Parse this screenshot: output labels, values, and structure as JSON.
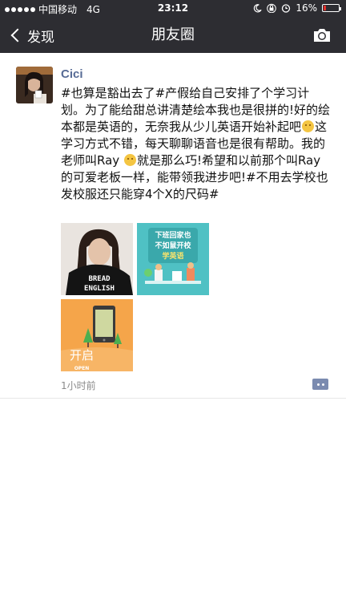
{
  "status_bar": {
    "carrier": "中国移动",
    "network": "4G",
    "time": "23:12",
    "battery": "16%",
    "battery_level": 0.16
  },
  "nav": {
    "back_label": "发现",
    "title": "朋友圈"
  },
  "post": {
    "author": "Cici",
    "text_parts": [
      "#也算是豁出去了#产假给自己安排了个学习计划。为了能给甜总讲清楚绘本我也是很拼的!好的绘本都是英语的，无奈我从少儿英语开始补起吧",
      "这学习方式不错，每天聊聊语音也是很有帮助。我的老师叫Ray ",
      "就是那么巧!希望和以前那个叫Ray的可爱老板一样，能带领我进步吧!#不用去学校也发校服还只能穿4个X的尺码#"
    ],
    "images": [
      {
        "shirt_text_1": "BREAD",
        "shirt_text_2": "ENGLISH"
      },
      {
        "title_line_1": "下班回家也",
        "title_line_2": "不如鼠开校",
        "title_line_3": "学英语"
      },
      {
        "label": "开启",
        "sublabel": "OPEN"
      }
    ],
    "timestamp": "1小时前"
  },
  "colors": {
    "bar_bg": "#2d2d32",
    "author": "#576b95",
    "timestamp": "#8a8a8a"
  }
}
